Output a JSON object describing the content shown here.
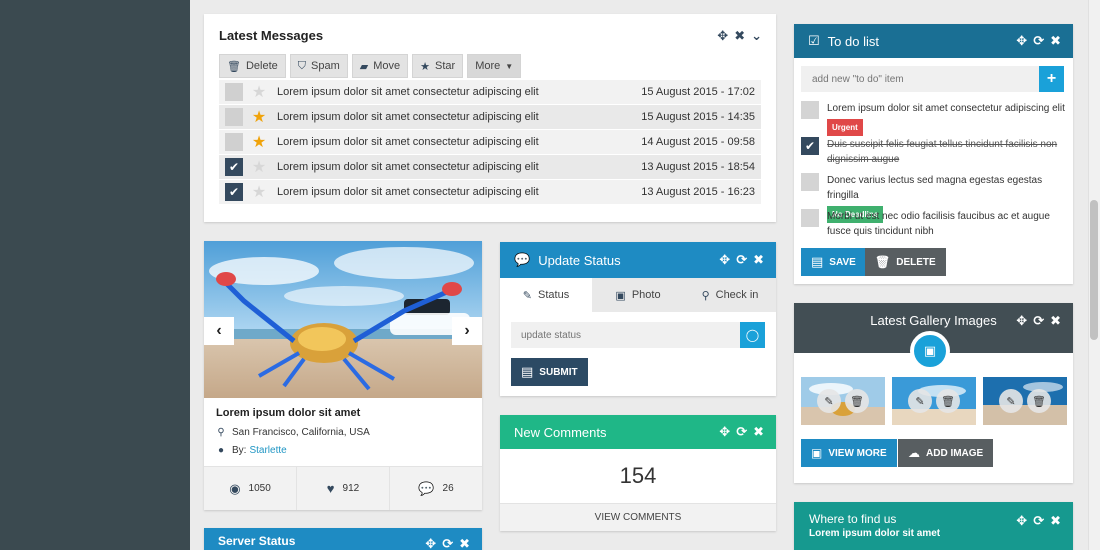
{
  "messages": {
    "title": "Latest Messages",
    "toolbar": {
      "delete": "Delete",
      "spam": "Spam",
      "move": "Move",
      "star": "Star",
      "more": "More"
    },
    "rows": [
      {
        "text": "Lorem ipsum dolor sit amet consectetur adipiscing elit",
        "date": "15 August 2015 - 17:02",
        "checked": false,
        "starred": false
      },
      {
        "text": "Lorem ipsum dolor sit amet consectetur adipiscing elit",
        "date": "15 August 2015 - 14:35",
        "checked": false,
        "starred": true
      },
      {
        "text": "Lorem ipsum dolor sit amet consectetur adipiscing elit",
        "date": "14 August 2015 - 09:58",
        "checked": false,
        "starred": true
      },
      {
        "text": "Lorem ipsum dolor sit amet consectetur adipiscing elit",
        "date": "13 August 2015 - 18:54",
        "checked": true,
        "starred": false
      },
      {
        "text": "Lorem ipsum dolor sit amet consectetur adipiscing elit",
        "date": "13 August 2015 - 16:23",
        "checked": true,
        "starred": false
      }
    ]
  },
  "card": {
    "title": "Lorem ipsum dolor sit amet",
    "location": "San Francisco, California, USA",
    "by_prefix": "By:",
    "author": "Starlette",
    "views": "1050",
    "likes": "912",
    "comments": "26"
  },
  "update_status": {
    "title": "Update Status",
    "tabs": [
      "Status",
      "Photo",
      "Check in"
    ],
    "placeholder": "update status",
    "submit": "SUBMIT"
  },
  "new_comments": {
    "title": "New Comments",
    "count": "154",
    "view": "VIEW COMMENTS"
  },
  "server_status": {
    "title": "Server Status"
  },
  "todo": {
    "title": "To do list",
    "placeholder": "add new \"to do\" item",
    "items": [
      {
        "text": "Lorem ipsum dolor sit amet consectetur adipiscing elit",
        "done": false,
        "badge": "Urgent"
      },
      {
        "text": "Duis suscipit felis feugiat tellus tincidunt facilisis non dignissim augue",
        "done": true,
        "badge": ""
      },
      {
        "text": "Donec varius lectus sed magna egestas egestas fringilla",
        "done": false,
        "badge": "No Deadline"
      },
      {
        "text": "Morbi ut est nec odio facilisis faucibus ac et augue fusce quis tincidunt nibh",
        "done": false,
        "badge": ""
      }
    ],
    "save": "SAVE",
    "delete": "DELETE"
  },
  "gallery": {
    "title": "Latest Gallery Images",
    "view_more": "VIEW MORE",
    "add_image": "ADD IMAGE"
  },
  "find_us": {
    "title": "Where to find us",
    "subtitle": "Lorem ipsum dolor sit amet"
  },
  "colors": {
    "blue_header": "#1e8bc3",
    "dark_blue_header": "#1a6f94",
    "green_header": "#1fb787",
    "teal_header": "#16998f",
    "dark_header": "#424e54",
    "sidebar": "#3b4a50"
  }
}
